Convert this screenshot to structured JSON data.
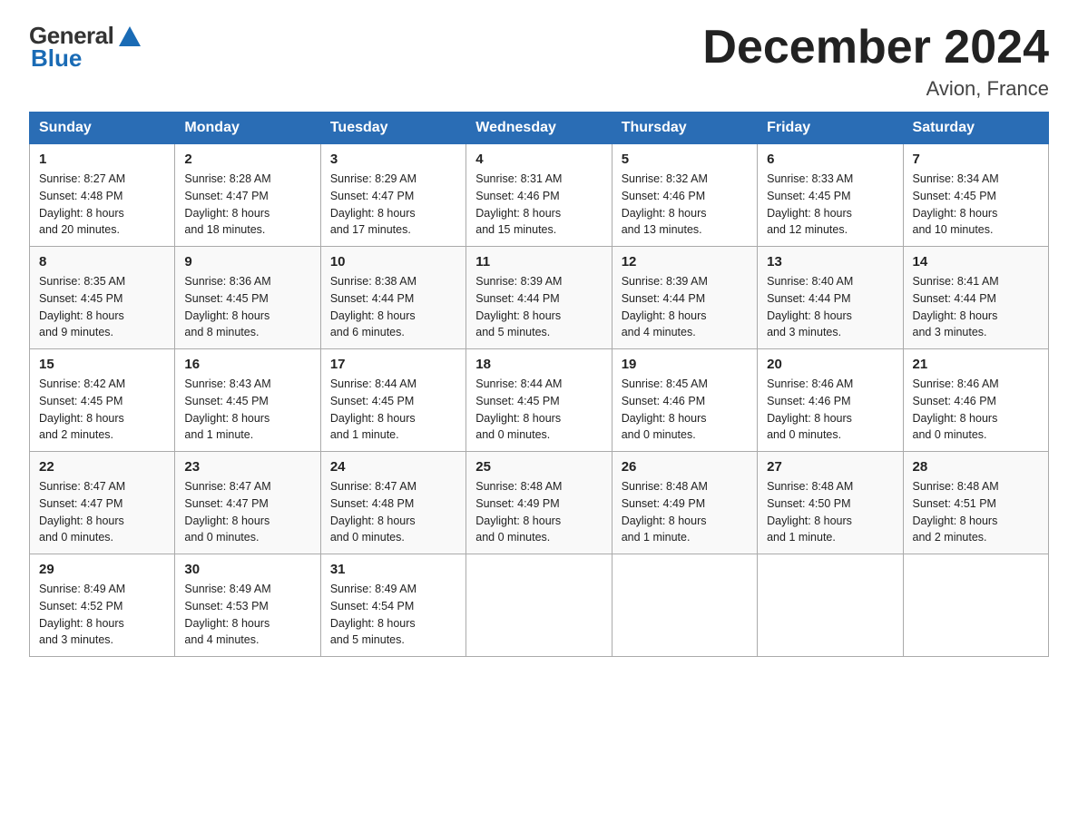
{
  "header": {
    "title": "December 2024",
    "subtitle": "Avion, France",
    "logo_general": "General",
    "logo_blue": "Blue"
  },
  "weekdays": [
    "Sunday",
    "Monday",
    "Tuesday",
    "Wednesday",
    "Thursday",
    "Friday",
    "Saturday"
  ],
  "weeks": [
    [
      {
        "day": "1",
        "sunrise": "8:27 AM",
        "sunset": "4:48 PM",
        "daylight": "8 hours and 20 minutes."
      },
      {
        "day": "2",
        "sunrise": "8:28 AM",
        "sunset": "4:47 PM",
        "daylight": "8 hours and 18 minutes."
      },
      {
        "day": "3",
        "sunrise": "8:29 AM",
        "sunset": "4:47 PM",
        "daylight": "8 hours and 17 minutes."
      },
      {
        "day": "4",
        "sunrise": "8:31 AM",
        "sunset": "4:46 PM",
        "daylight": "8 hours and 15 minutes."
      },
      {
        "day": "5",
        "sunrise": "8:32 AM",
        "sunset": "4:46 PM",
        "daylight": "8 hours and 13 minutes."
      },
      {
        "day": "6",
        "sunrise": "8:33 AM",
        "sunset": "4:45 PM",
        "daylight": "8 hours and 12 minutes."
      },
      {
        "day": "7",
        "sunrise": "8:34 AM",
        "sunset": "4:45 PM",
        "daylight": "8 hours and 10 minutes."
      }
    ],
    [
      {
        "day": "8",
        "sunrise": "8:35 AM",
        "sunset": "4:45 PM",
        "daylight": "8 hours and 9 minutes."
      },
      {
        "day": "9",
        "sunrise": "8:36 AM",
        "sunset": "4:45 PM",
        "daylight": "8 hours and 8 minutes."
      },
      {
        "day": "10",
        "sunrise": "8:38 AM",
        "sunset": "4:44 PM",
        "daylight": "8 hours and 6 minutes."
      },
      {
        "day": "11",
        "sunrise": "8:39 AM",
        "sunset": "4:44 PM",
        "daylight": "8 hours and 5 minutes."
      },
      {
        "day": "12",
        "sunrise": "8:39 AM",
        "sunset": "4:44 PM",
        "daylight": "8 hours and 4 minutes."
      },
      {
        "day": "13",
        "sunrise": "8:40 AM",
        "sunset": "4:44 PM",
        "daylight": "8 hours and 3 minutes."
      },
      {
        "day": "14",
        "sunrise": "8:41 AM",
        "sunset": "4:44 PM",
        "daylight": "8 hours and 3 minutes."
      }
    ],
    [
      {
        "day": "15",
        "sunrise": "8:42 AM",
        "sunset": "4:45 PM",
        "daylight": "8 hours and 2 minutes."
      },
      {
        "day": "16",
        "sunrise": "8:43 AM",
        "sunset": "4:45 PM",
        "daylight": "8 hours and 1 minute."
      },
      {
        "day": "17",
        "sunrise": "8:44 AM",
        "sunset": "4:45 PM",
        "daylight": "8 hours and 1 minute."
      },
      {
        "day": "18",
        "sunrise": "8:44 AM",
        "sunset": "4:45 PM",
        "daylight": "8 hours and 0 minutes."
      },
      {
        "day": "19",
        "sunrise": "8:45 AM",
        "sunset": "4:46 PM",
        "daylight": "8 hours and 0 minutes."
      },
      {
        "day": "20",
        "sunrise": "8:46 AM",
        "sunset": "4:46 PM",
        "daylight": "8 hours and 0 minutes."
      },
      {
        "day": "21",
        "sunrise": "8:46 AM",
        "sunset": "4:46 PM",
        "daylight": "8 hours and 0 minutes."
      }
    ],
    [
      {
        "day": "22",
        "sunrise": "8:47 AM",
        "sunset": "4:47 PM",
        "daylight": "8 hours and 0 minutes."
      },
      {
        "day": "23",
        "sunrise": "8:47 AM",
        "sunset": "4:47 PM",
        "daylight": "8 hours and 0 minutes."
      },
      {
        "day": "24",
        "sunrise": "8:47 AM",
        "sunset": "4:48 PM",
        "daylight": "8 hours and 0 minutes."
      },
      {
        "day": "25",
        "sunrise": "8:48 AM",
        "sunset": "4:49 PM",
        "daylight": "8 hours and 0 minutes."
      },
      {
        "day": "26",
        "sunrise": "8:48 AM",
        "sunset": "4:49 PM",
        "daylight": "8 hours and 1 minute."
      },
      {
        "day": "27",
        "sunrise": "8:48 AM",
        "sunset": "4:50 PM",
        "daylight": "8 hours and 1 minute."
      },
      {
        "day": "28",
        "sunrise": "8:48 AM",
        "sunset": "4:51 PM",
        "daylight": "8 hours and 2 minutes."
      }
    ],
    [
      {
        "day": "29",
        "sunrise": "8:49 AM",
        "sunset": "4:52 PM",
        "daylight": "8 hours and 3 minutes."
      },
      {
        "day": "30",
        "sunrise": "8:49 AM",
        "sunset": "4:53 PM",
        "daylight": "8 hours and 4 minutes."
      },
      {
        "day": "31",
        "sunrise": "8:49 AM",
        "sunset": "4:54 PM",
        "daylight": "8 hours and 5 minutes."
      },
      null,
      null,
      null,
      null
    ]
  ],
  "labels": {
    "sunrise": "Sunrise:",
    "sunset": "Sunset:",
    "daylight": "Daylight:"
  }
}
